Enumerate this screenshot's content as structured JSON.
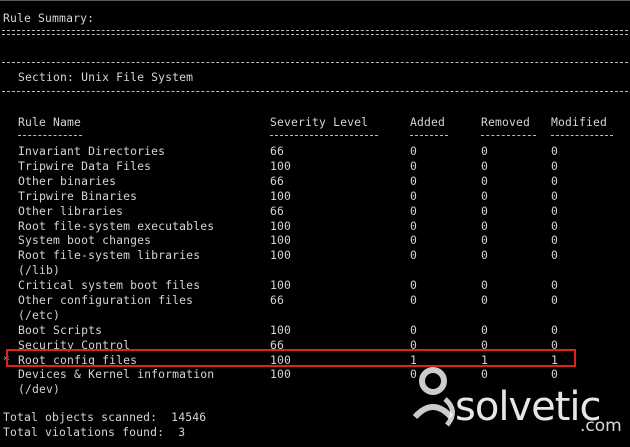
{
  "summary": {
    "heading": "Rule Summary:",
    "section": "Section: Unix File System"
  },
  "columns": {
    "rule_name": "Rule Name",
    "severity": "Severity Level",
    "added": "Added",
    "removed": "Removed",
    "modified": "Modified"
  },
  "rows": [
    {
      "marker": "",
      "name": "Invariant Directories",
      "severity": "66",
      "added": "0",
      "removed": "0",
      "modified": "0"
    },
    {
      "marker": "",
      "name": "Tripwire Data Files",
      "severity": "100",
      "added": "0",
      "removed": "0",
      "modified": "0"
    },
    {
      "marker": "",
      "name": "Other binaries",
      "severity": "66",
      "added": "0",
      "removed": "0",
      "modified": "0"
    },
    {
      "marker": "",
      "name": "Tripwire Binaries",
      "severity": "100",
      "added": "0",
      "removed": "0",
      "modified": "0"
    },
    {
      "marker": "",
      "name": "Other libraries",
      "severity": "66",
      "added": "0",
      "removed": "0",
      "modified": "0"
    },
    {
      "marker": "",
      "name": "Root file-system executables",
      "severity": "100",
      "added": "0",
      "removed": "0",
      "modified": "0"
    },
    {
      "marker": "",
      "name": "System boot changes",
      "severity": "100",
      "added": "0",
      "removed": "0",
      "modified": "0"
    },
    {
      "marker": "",
      "name": "Root file-system libraries",
      "name2": "(/lib)",
      "severity": "100",
      "added": "0",
      "removed": "0",
      "modified": "0"
    },
    {
      "marker": "",
      "name": "Critical system boot files",
      "severity": "100",
      "added": "0",
      "removed": "0",
      "modified": "0"
    },
    {
      "marker": "",
      "name": "Other configuration files",
      "name2": "(/etc)",
      "severity": "66",
      "added": "0",
      "removed": "0",
      "modified": "0"
    },
    {
      "marker": "",
      "name": "Boot Scripts",
      "severity": "100",
      "added": "0",
      "removed": "0",
      "modified": "0"
    },
    {
      "marker": "",
      "name": "Security Control",
      "severity": "66",
      "added": "0",
      "removed": "0",
      "modified": "0"
    },
    {
      "marker": "*",
      "name": "Root config files",
      "severity": "100",
      "added": "1",
      "removed": "1",
      "modified": "1"
    },
    {
      "marker": "",
      "name": "Devices & Kernel information",
      "name2": "(/dev)",
      "severity": "100",
      "added": "0",
      "removed": "0",
      "modified": "0"
    }
  ],
  "totals": {
    "scanned": "Total objects scanned:  14546",
    "violations": "Total violations found:  3"
  },
  "watermark": {
    "brand": "solvetic",
    "suffix": ".com"
  },
  "colors": {
    "background": "#000000",
    "text": "#d4d4d4",
    "highlight": "#e0201c"
  }
}
